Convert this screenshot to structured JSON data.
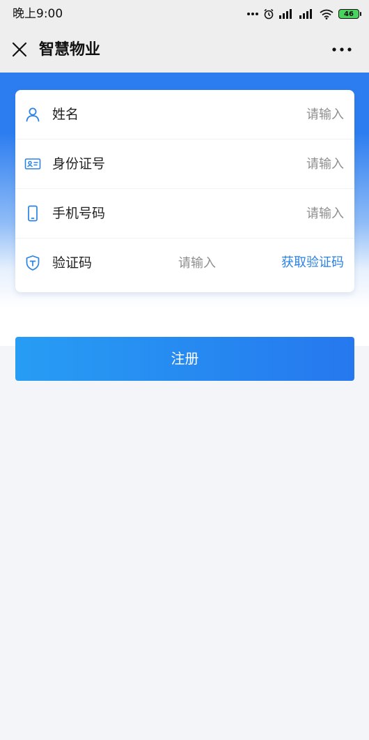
{
  "status_bar": {
    "time": "晚上9:00",
    "battery": "46",
    "signal_label_1": "ıll",
    "signal_label_2": "ıll"
  },
  "nav": {
    "title": "智慧物业",
    "close_icon": "close-icon",
    "more_icon": "more-dots-icon"
  },
  "form": {
    "fields": [
      {
        "label": "姓名",
        "placeholder": "请输入",
        "icon": "user-icon"
      },
      {
        "label": "身份证号",
        "placeholder": "请输入",
        "icon": "id-card-icon"
      },
      {
        "label": "手机号码",
        "placeholder": "请输入",
        "icon": "phone-icon"
      },
      {
        "label": "验证码",
        "placeholder": "请输入",
        "icon": "shield-icon"
      }
    ],
    "get_code_label": "获取验证码"
  },
  "register_button": {
    "label": "注册"
  },
  "colors": {
    "accent_blue": "#2a82e4",
    "header_gradient_top": "#2c7df0",
    "button_gradient_start": "#279df4",
    "button_gradient_end": "#2678ee",
    "page_background": "#f3f5f8"
  }
}
